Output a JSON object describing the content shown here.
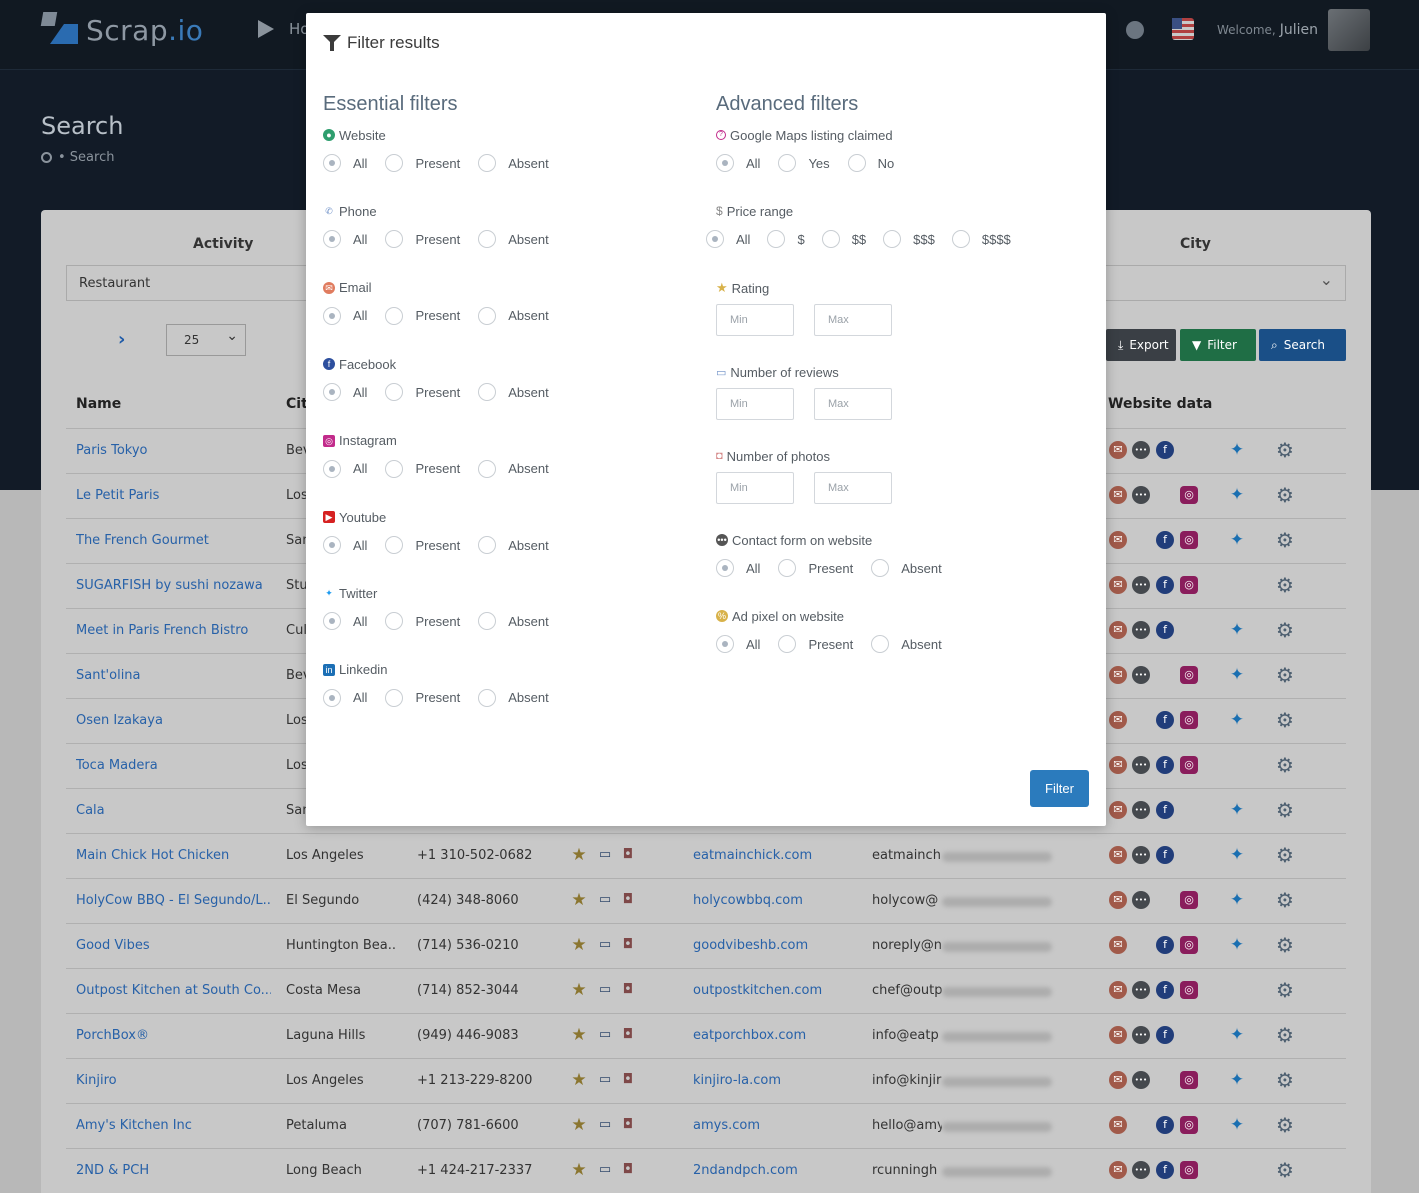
{
  "app": {
    "logo_main": "Scrap",
    "logo_suffix": ".io",
    "nav_partial": "Ho",
    "welcome": "Welcome,",
    "user": "Julien"
  },
  "page": {
    "title": "Search",
    "breadcrumb": "• Search"
  },
  "search_form": {
    "activity_label": "Activity",
    "activity_value": "Restaurant",
    "city_label": "City",
    "per_page": "25",
    "export_label": "Export",
    "filter_label": "Filter",
    "search_label": "Search"
  },
  "table": {
    "headers": {
      "name": "Name",
      "city": "Cit",
      "website_data": "Website data"
    },
    "hidden_rows": [
      {
        "name": "Paris Tokyo",
        "city": "Bev"
      },
      {
        "name": "Le Petit Paris",
        "city": "Los"
      },
      {
        "name": "The French Gourmet",
        "city": "San"
      },
      {
        "name": "SUGARFISH by sushi nozawa",
        "city": "Stu"
      },
      {
        "name": "Meet in Paris French Bistro",
        "city": "Cul"
      },
      {
        "name": "Sant'olina",
        "city": "Bev"
      },
      {
        "name": "Osen Izakaya",
        "city": "Los"
      },
      {
        "name": "Toca Madera",
        "city": "Los"
      },
      {
        "name": "Cala",
        "city": "San"
      }
    ],
    "rows": [
      {
        "name": "Main Chick Hot Chicken",
        "city": "Los Angeles",
        "phone": "+1 310-502-0682",
        "site": "eatmainchick.com",
        "email": "eatmainch"
      },
      {
        "name": "HolyCow BBQ - El Segundo/L...",
        "city": "El Segundo",
        "phone": "(424) 348-8060",
        "site": "holycowbbq.com",
        "email": "holycow@"
      },
      {
        "name": "Good Vibes",
        "city": "Huntington Bea...",
        "phone": "(714) 536-0210",
        "site": "goodvibeshb.com",
        "email": "noreply@n"
      },
      {
        "name": "Outpost Kitchen at South Co...",
        "city": "Costa Mesa",
        "phone": "(714) 852-3044",
        "site": "outpostkitchen.com",
        "email": "chef@outp"
      },
      {
        "name": "PorchBox®",
        "city": "Laguna Hills",
        "phone": "(949) 446-9083",
        "site": "eatporchbox.com",
        "email": "info@eatp"
      },
      {
        "name": "Kinjiro",
        "city": "Los Angeles",
        "phone": "+1 213-229-8200",
        "site": "kinjiro-la.com",
        "email": "info@kinjir"
      },
      {
        "name": "Amy's Kitchen Inc",
        "city": "Petaluma",
        "phone": "(707) 781-6600",
        "site": "amys.com",
        "email": "hello@amy"
      },
      {
        "name": "2ND & PCH",
        "city": "Long Beach",
        "phone": "+1 424-217-2337",
        "site": "2ndandpch.com",
        "email": "rcunningh"
      }
    ]
  },
  "modal": {
    "title": "Filter results",
    "essential_title": "Essential filters",
    "advanced_title": "Advanced filters",
    "essential": [
      {
        "label": "Website",
        "icon": "globe-icon",
        "color": "#2e9e6e",
        "options": [
          "All",
          "Present",
          "Absent"
        ]
      },
      {
        "label": "Phone",
        "icon": "phone-icon",
        "color": "#6d8fc7",
        "options": [
          "All",
          "Present",
          "Absent"
        ]
      },
      {
        "label": "Email",
        "icon": "mail-icon",
        "color": "#e07c5f",
        "options": [
          "All",
          "Present",
          "Absent"
        ]
      },
      {
        "label": "Facebook",
        "icon": "facebook-icon",
        "color": "#2d4f9e",
        "options": [
          "All",
          "Present",
          "Absent"
        ]
      },
      {
        "label": "Instagram",
        "icon": "instagram-icon",
        "color": "#c22b8b",
        "options": [
          "All",
          "Present",
          "Absent"
        ]
      },
      {
        "label": "Youtube",
        "icon": "youtube-icon",
        "color": "#d62121",
        "options": [
          "All",
          "Present",
          "Absent"
        ]
      },
      {
        "label": "Twitter",
        "icon": "twitter-icon",
        "color": "#1d9bf0",
        "options": [
          "All",
          "Present",
          "Absent"
        ]
      },
      {
        "label": "Linkedin",
        "icon": "linkedin-icon",
        "color": "#1c6fb5",
        "options": [
          "All",
          "Present",
          "Absent"
        ]
      }
    ],
    "advanced": {
      "gmb_label": "Google Maps listing claimed",
      "gmb_options": [
        "All",
        "Yes",
        "No"
      ],
      "price_label": "Price range",
      "price_options": [
        "All",
        "$",
        "$$",
        "$$$",
        "$$$$"
      ],
      "rating_label": "Rating",
      "reviews_label": "Number of reviews",
      "photos_label": "Number of photos",
      "min_placeholder": "Min",
      "max_placeholder": "Max",
      "contact_label": "Contact form on website",
      "contact_options": [
        "All",
        "Present",
        "Absent"
      ],
      "pixel_label": "Ad pixel on website",
      "pixel_options": [
        "All",
        "Present",
        "Absent"
      ]
    },
    "submit_label": "Filter"
  },
  "colors": {
    "accent": "#2b7bbd",
    "topbar": "#111922",
    "link": "#2761a8"
  }
}
